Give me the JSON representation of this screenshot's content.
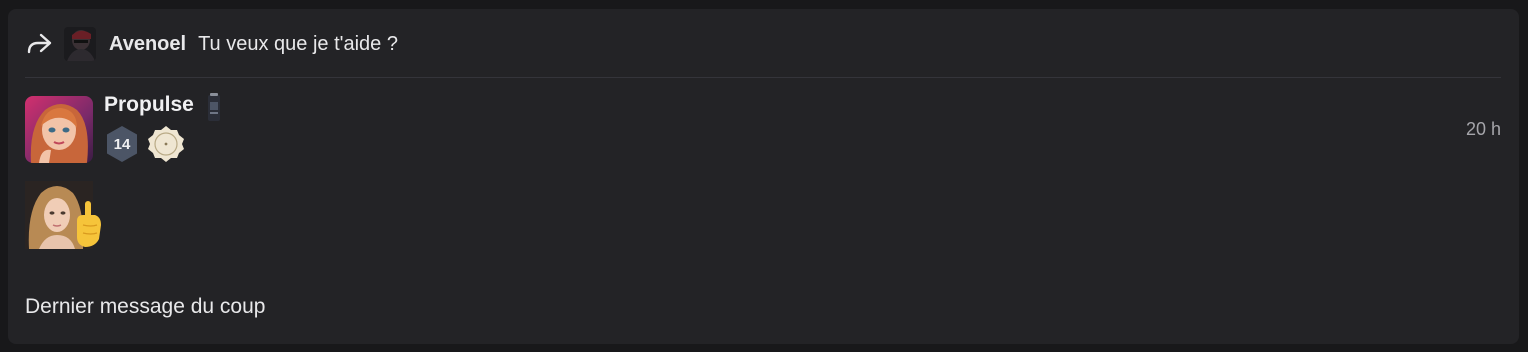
{
  "reply": {
    "icon": "share-forward-icon",
    "author": "Avenoel",
    "text": "Tu veux que je t'aide ?"
  },
  "post": {
    "username": "Propulse",
    "username_icon": "can-icon",
    "level": "14",
    "badge_icon": "moon-medal-icon",
    "timestamp": "20 h",
    "sticker": "girl-pointing-up-sticker",
    "message": "Dernier message du coup"
  },
  "colors": {
    "background": "#18181a",
    "card": "#232326",
    "text": "#e8e8ea",
    "muted": "#a5a5aa",
    "level_badge": "#4c5566"
  }
}
